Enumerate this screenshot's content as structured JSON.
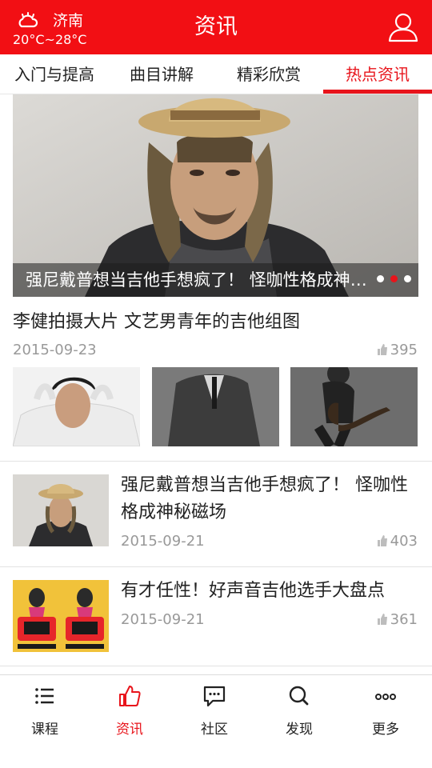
{
  "header": {
    "city": "济南",
    "temperature": "20°C~28°C",
    "title": "资讯",
    "weather_icon": "cloudy-sun-icon",
    "user_icon": "user-icon",
    "background_color": "#f20f14"
  },
  "tabs": [
    {
      "label": "入门与提高",
      "active": false
    },
    {
      "label": "曲目讲解",
      "active": false
    },
    {
      "label": "精彩欣赏",
      "active": false
    },
    {
      "label": "热点资讯",
      "active": true
    }
  ],
  "banner": {
    "caption": "强尼戴普想当吉他手想疯了！ 怪咖性格成神秘磁场",
    "slide_count": 3,
    "active_slide": 2
  },
  "articles": {
    "gallery": {
      "title": "李健拍摄大片 文艺男青年的吉他组图",
      "date": "2015-09-23",
      "likes": "395"
    },
    "items": [
      {
        "title": "强尼戴普想当吉他手想疯了！ 怪咖性格成神秘磁场",
        "date": "2015-09-21",
        "likes": "403"
      },
      {
        "title": "有才任性！好声音吉他选手大盘点",
        "date": "2015-09-21",
        "likes": "361"
      }
    ]
  },
  "bottom_nav": [
    {
      "label": "课程",
      "icon": "list-icon",
      "active": false
    },
    {
      "label": "资讯",
      "icon": "thumbs-up-icon",
      "active": true
    },
    {
      "label": "社区",
      "icon": "chat-bubble-icon",
      "active": false
    },
    {
      "label": "发现",
      "icon": "search-icon",
      "active": false
    },
    {
      "label": "更多",
      "icon": "more-dots-icon",
      "active": false
    }
  ],
  "colors": {
    "accent": "#e8141b",
    "muted_text": "#999999"
  }
}
